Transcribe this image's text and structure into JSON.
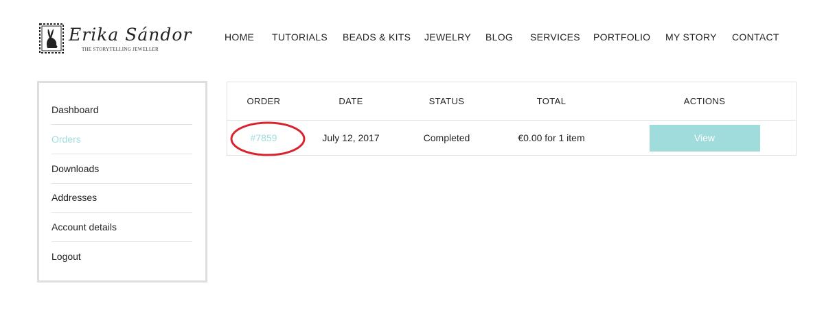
{
  "brand": {
    "name": "Erika Sándor",
    "tagline": "THE STORYTELLING JEWELLER",
    "logo_icon": "rabbit-stamp-icon"
  },
  "nav": {
    "items": [
      "HOME",
      "TUTORIALS",
      "BEADS & KITS",
      "JEWELRY",
      "BLOG",
      "SERVICES",
      "PORTFOLIO",
      "MY STORY",
      "CONTACT"
    ]
  },
  "sidebar": {
    "items": [
      {
        "label": "Dashboard",
        "active": false
      },
      {
        "label": "Orders",
        "active": true
      },
      {
        "label": "Downloads",
        "active": false
      },
      {
        "label": "Addresses",
        "active": false
      },
      {
        "label": "Account details",
        "active": false
      },
      {
        "label": "Logout",
        "active": false
      }
    ]
  },
  "orders": {
    "headers": {
      "order": "ORDER",
      "date": "DATE",
      "status": "STATUS",
      "total": "TOTAL",
      "actions": "ACTIONS"
    },
    "rows": [
      {
        "order": "#7859",
        "date": "July 12, 2017",
        "status": "Completed",
        "total": "€0.00 for 1 item",
        "action_label": "View"
      }
    ]
  },
  "colors": {
    "accent": "#9fdcdc",
    "button": "#a0dcdc",
    "highlight_ring": "#d9232e",
    "border": "#dedede"
  }
}
